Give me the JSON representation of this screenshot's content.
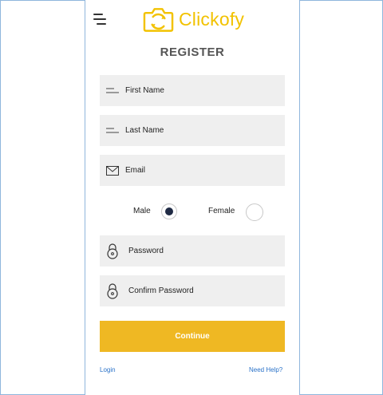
{
  "brand": {
    "name": "Clickofy",
    "icon": "camera-icon",
    "color": "#f2c200"
  },
  "form": {
    "title": "REGISTER",
    "fields": [
      {
        "label": "First Name",
        "icon": "lines-icon"
      },
      {
        "label": "Last Name",
        "icon": "lines-icon"
      },
      {
        "label": "Email",
        "icon": "envelope-icon"
      },
      {
        "label": "Password",
        "icon": "lock-icon"
      },
      {
        "label": "Confirm Password",
        "icon": "lock-icon"
      }
    ],
    "gender": {
      "male_label": "Male",
      "female_label": "Female",
      "selected": "Male"
    },
    "continue_label": "Continue",
    "accent": "#efb823"
  },
  "footer": {
    "login_label": "Login",
    "help_label": "Need Help?"
  }
}
